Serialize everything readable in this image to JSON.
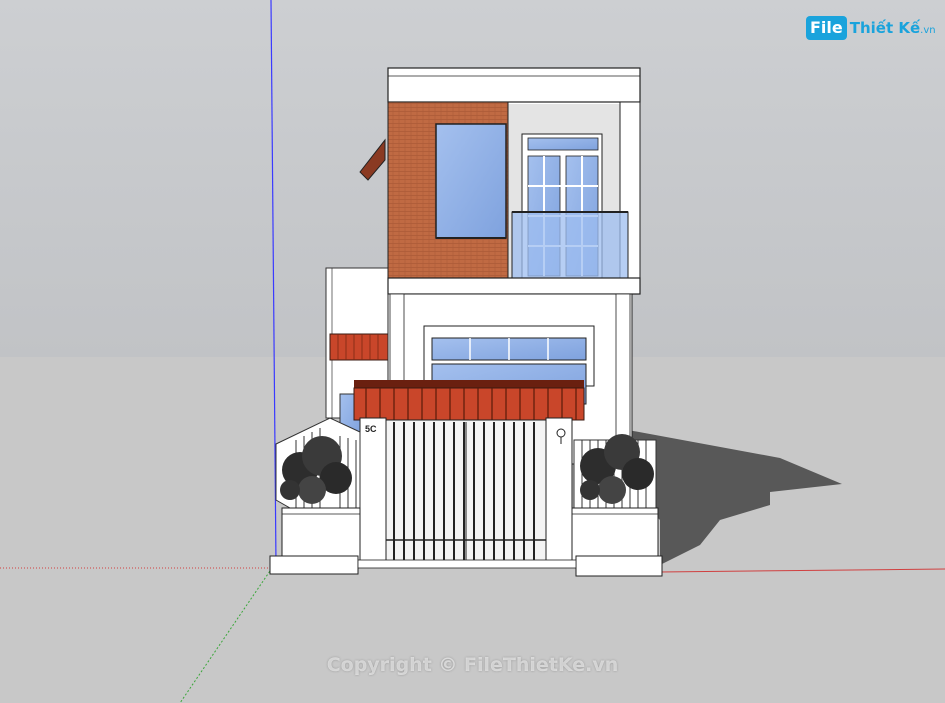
{
  "watermark": {
    "logo_box": "File",
    "logo_text": "Thiết Kế",
    "logo_tld": ".vn",
    "copyright": "Copyright © FileThietKe.vn"
  },
  "house": {
    "number_plate": "5C"
  },
  "colors": {
    "sky": "#c7c9cc",
    "ground": "#c8c8c8",
    "brick": "#c06a43",
    "glass": "#8fb1e6",
    "roof_tile": "#c9462a",
    "wall": "#ffffff",
    "shadow": "#555555",
    "axis_blue": "#3a3aff",
    "axis_red": "#d04040",
    "axis_green": "#3aa63a",
    "brand": "#1aa3dc"
  }
}
